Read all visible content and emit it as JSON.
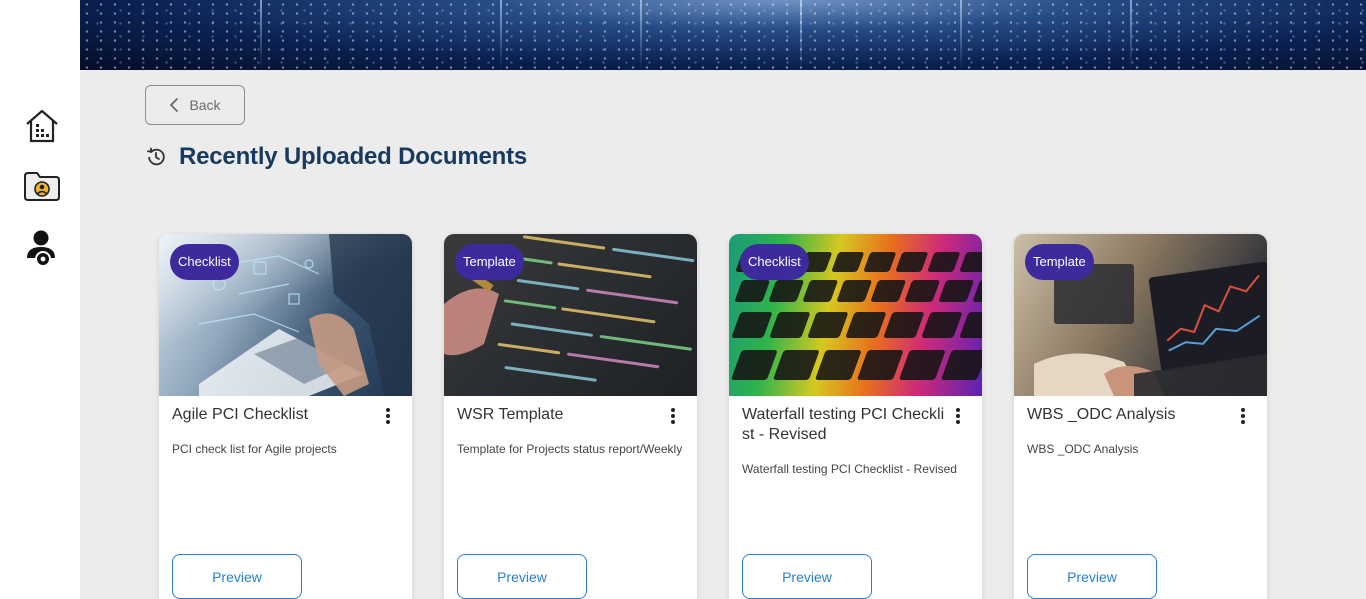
{
  "sidebar": {
    "items": [
      {
        "icon": "building-icon"
      },
      {
        "icon": "user-folder-icon"
      },
      {
        "icon": "user-settings-icon"
      }
    ]
  },
  "back_label": "Back",
  "page_title": "Recently Uploaded Documents",
  "cards": [
    {
      "badge": "Checklist",
      "title": "Agile PCI Checklist",
      "description": "PCI check list for Agile projects",
      "preview_label": "Preview"
    },
    {
      "badge": "Template",
      "title": "WSR Template",
      "description": "Template for Projects status report/Weekly",
      "preview_label": "Preview"
    },
    {
      "badge": "Checklist",
      "title": "Waterfall testing PCI Checklist - Revised",
      "description": "Waterfall testing PCI Checklist - Revised",
      "preview_label": "Preview"
    },
    {
      "badge": "Template",
      "title": "WBS _ODC Analysis",
      "description": "WBS _ODC Analysis",
      "preview_label": "Preview"
    }
  ],
  "colors": {
    "badge_bg": "#3d2a9c",
    "title": "#173a5e",
    "preview_accent": "#2a7fd1"
  }
}
